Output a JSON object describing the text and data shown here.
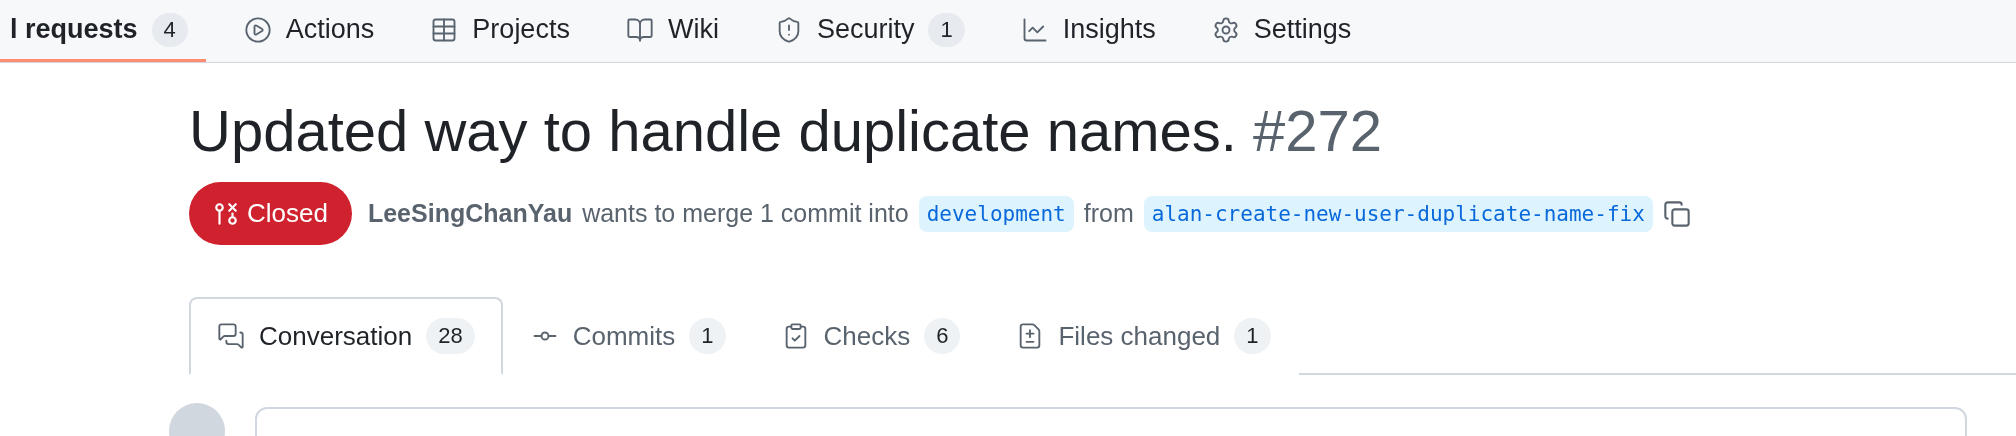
{
  "repo_nav": {
    "items": [
      {
        "label": "l requests",
        "counter": "4",
        "selected": true
      },
      {
        "label": "Actions",
        "selected": false
      },
      {
        "label": "Projects",
        "selected": false
      },
      {
        "label": "Wiki",
        "selected": false
      },
      {
        "label": "Security",
        "counter": "1",
        "selected": false
      },
      {
        "label": "Insights",
        "selected": false
      },
      {
        "label": "Settings",
        "selected": false
      }
    ]
  },
  "pull_request": {
    "title": "Updated way to handle duplicate names.",
    "number": "#272",
    "state": {
      "label": "Closed",
      "kind": "closed"
    },
    "author": "LeeSingChanYau",
    "merge_text": "wants to merge 1 commit into",
    "base_branch": "development",
    "from_text": "from",
    "head_branch": "alan-create-new-user-duplicate-name-fix"
  },
  "tabs": [
    {
      "label": "Conversation",
      "count": "28",
      "selected": true
    },
    {
      "label": "Commits",
      "count": "1",
      "selected": false
    },
    {
      "label": "Checks",
      "count": "6",
      "selected": false
    },
    {
      "label": "Files changed",
      "count": "1",
      "selected": false
    }
  ]
}
